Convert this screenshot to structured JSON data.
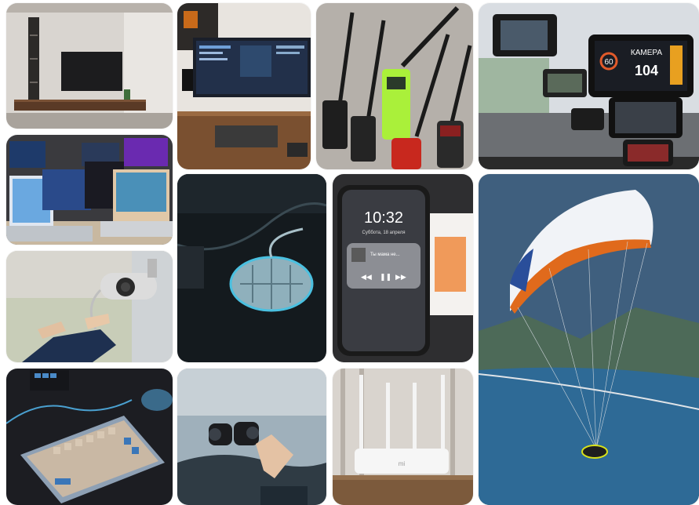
{
  "gallery": {
    "tiles": [
      {
        "id": "living-room-tv",
        "icon": "tv-icon"
      },
      {
        "id": "monitor-desk-setup",
        "icon": "monitor-icon"
      },
      {
        "id": "walkie-talkies",
        "icon": "radio-icon"
      },
      {
        "id": "dashcams",
        "icon": "camera-icon"
      },
      {
        "id": "laptops",
        "icon": "laptop-icon"
      },
      {
        "id": "gaming-mouse",
        "icon": "mouse-icon"
      },
      {
        "id": "smartphone",
        "icon": "phone-icon"
      },
      {
        "id": "paraglider",
        "icon": "paraglider-icon"
      },
      {
        "id": "cctv-camera",
        "icon": "cctv-icon"
      },
      {
        "id": "mechanical-keyboard",
        "icon": "keyboard-icon"
      },
      {
        "id": "binoculars",
        "icon": "binoculars-icon"
      },
      {
        "id": "wifi-router",
        "icon": "router-icon"
      }
    ],
    "phone_screen": {
      "time": "10:32",
      "date": "Суббота, 18 апреля",
      "track_title": "Ты мама не..."
    },
    "dashcam_screen": {
      "label": "КАМЕРА",
      "speed_left": "60",
      "speed_right": "104"
    },
    "router_brand": "mi"
  }
}
